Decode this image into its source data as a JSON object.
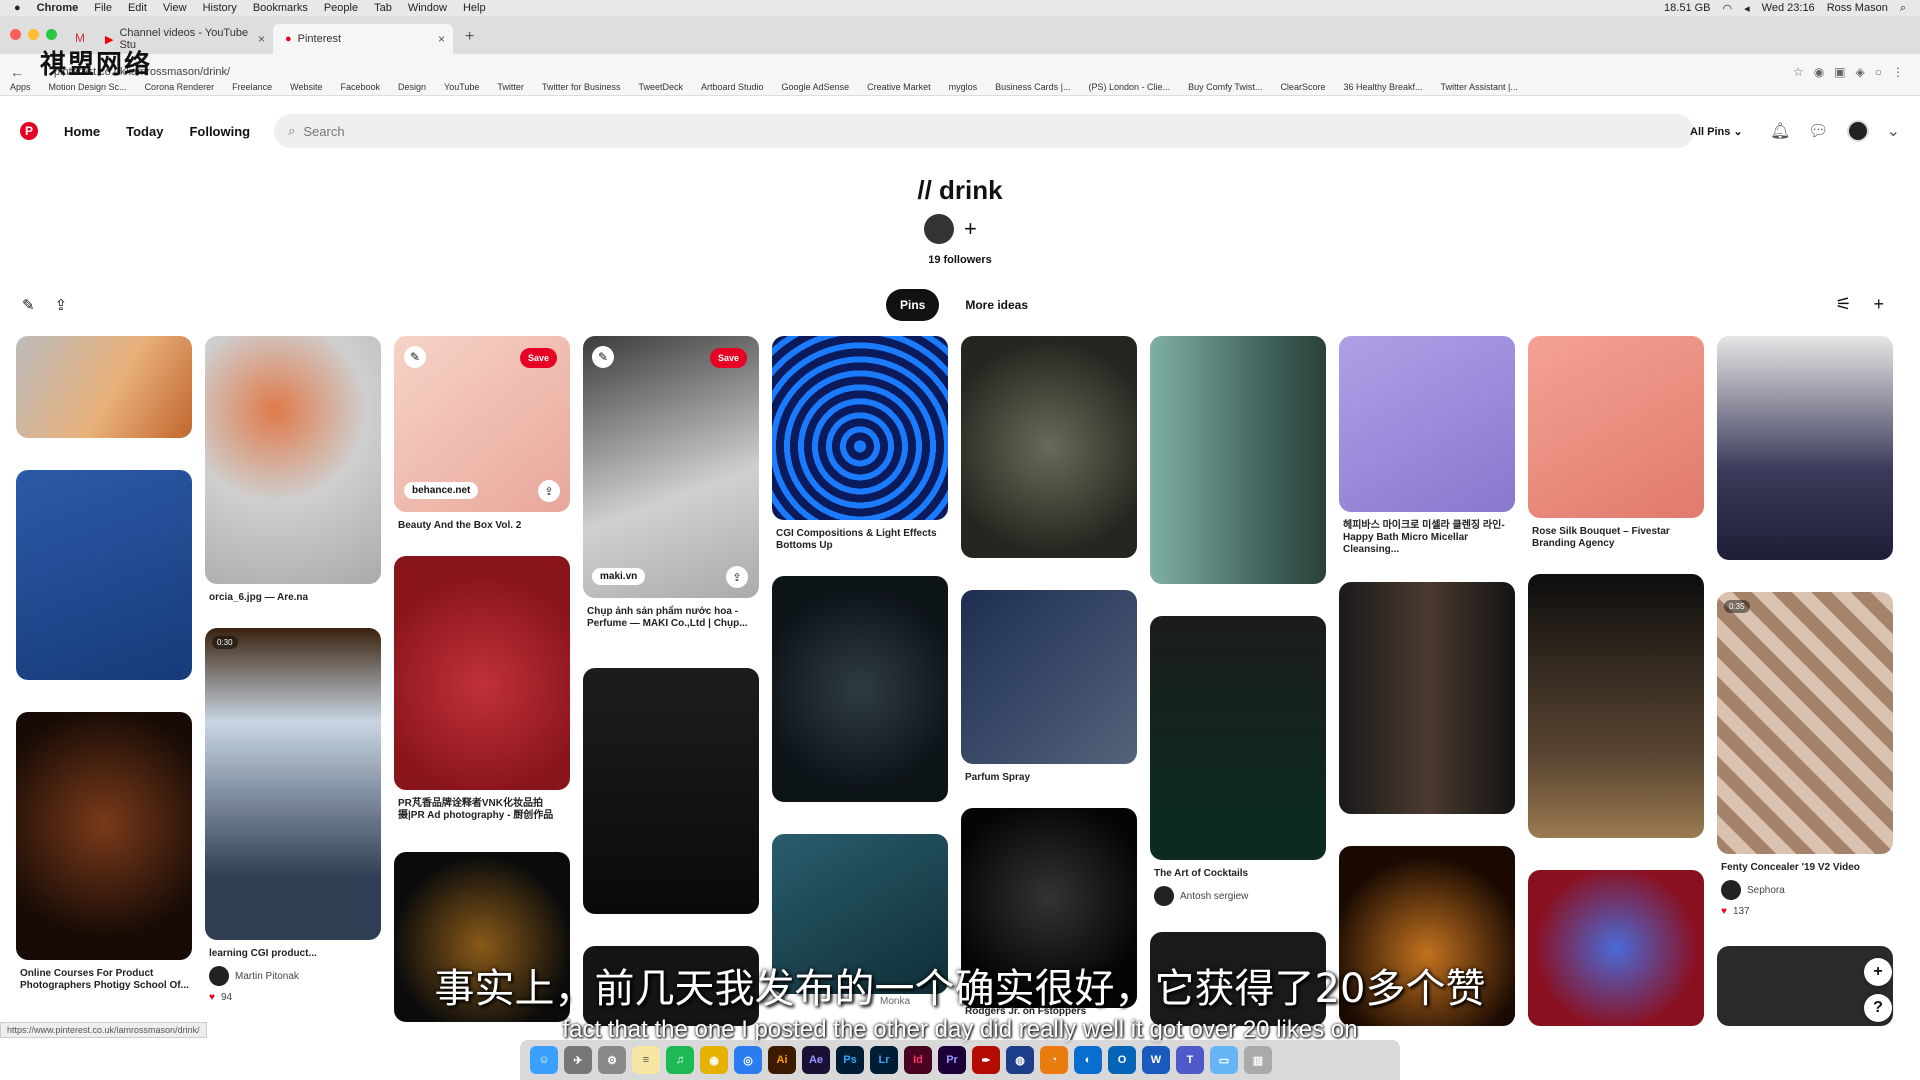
{
  "menubar": {
    "apple": "",
    "app": "Chrome",
    "items": [
      "File",
      "Edit",
      "View",
      "History",
      "Bookmarks",
      "People",
      "Tab",
      "Window",
      "Help"
    ],
    "storage": "18.51 GB",
    "clock": "Wed 23:16",
    "user": "Ross Mason"
  },
  "tabs": [
    {
      "label": "Channel videos - YouTube Stu"
    },
    {
      "label": "Pinterest"
    }
  ],
  "url": "pinterest.co.uk/iamrossmason/drink/",
  "watermark": "祺盟网络",
  "bookmarks": [
    "Apps",
    "Motion Design Sc...",
    "Corona Renderer",
    "Freelance",
    "Website",
    "Facebook",
    "Design",
    "YouTube",
    "Twitter",
    "Twitter for Business",
    "TweetDeck",
    "Artboard Studio",
    "Google AdSense",
    "Creative Market",
    "myglos",
    "Business Cards |...",
    "(PS) London - Clie...",
    "Buy Comfy Twist...",
    "ClearScore",
    "36 Healthy Breakf...",
    "Twitter Assistant |..."
  ],
  "nav": {
    "home": "Home",
    "today": "Today",
    "following": "Following",
    "search_placeholder": "Search",
    "all_pins": "All Pins"
  },
  "board": {
    "title": "// drink",
    "followers": "19 followers",
    "tab_pins": "Pins",
    "tab_more": "More ideas"
  },
  "pins": [
    {
      "caption": ""
    },
    {
      "caption": "orcia_6.jpg — Are.na"
    },
    {
      "caption": "Beauty And the Box Vol. 2",
      "source": "behance.net",
      "save": "Save"
    },
    {
      "caption": "Chụp ảnh sản phẩm nước hoa - Perfume — MAKI Co.,Ltd | Chụp...",
      "source": "maki.vn",
      "save": "Save"
    },
    {
      "caption": "CGI Compositions & Light Effects Bottoms Up"
    },
    {
      "caption": "Parfum Spray"
    },
    {
      "caption": "The Art of Cocktails",
      "author": "Antosh sergiew"
    },
    {
      "caption": "헤피바스 마이크로 미셀라 클렌징 라인-Happy Bath Micro Micellar Cleansing..."
    },
    {
      "caption": "Rose Silk Bouquet – Fivestar Branding Agency"
    },
    {
      "caption": "Fenty Concealer '19 V2 Video",
      "author": "Sephora",
      "reactions": "137",
      "duration": "0:35"
    },
    {
      "caption": "Online Courses For Product Photographers Photigy School Of..."
    },
    {
      "caption": "learning CGI product...",
      "author": "Martin Pitonak",
      "reactions": "94",
      "duration": "0:30"
    },
    {
      "caption": "PR芃香品牌诠释者VNK化妆品拍摄|PR Ad photography - 厨创作品"
    },
    {
      "caption": "Rodgers Jr. on Fstoppers"
    },
    {
      "caption": "Monka"
    }
  ],
  "subtitle_cn": "事实上，前几天我发布的一个确实很好，它获得了20多个赞",
  "subtitle_en": "fact that the one I posted the other day did really well it got over 20 likes on",
  "status_url": "https://www.pinterest.co.uk/iamrossmason/drink/",
  "dock": [
    "Ai",
    "Ae",
    "Ps",
    "Lr",
    "Id",
    "Pr"
  ]
}
